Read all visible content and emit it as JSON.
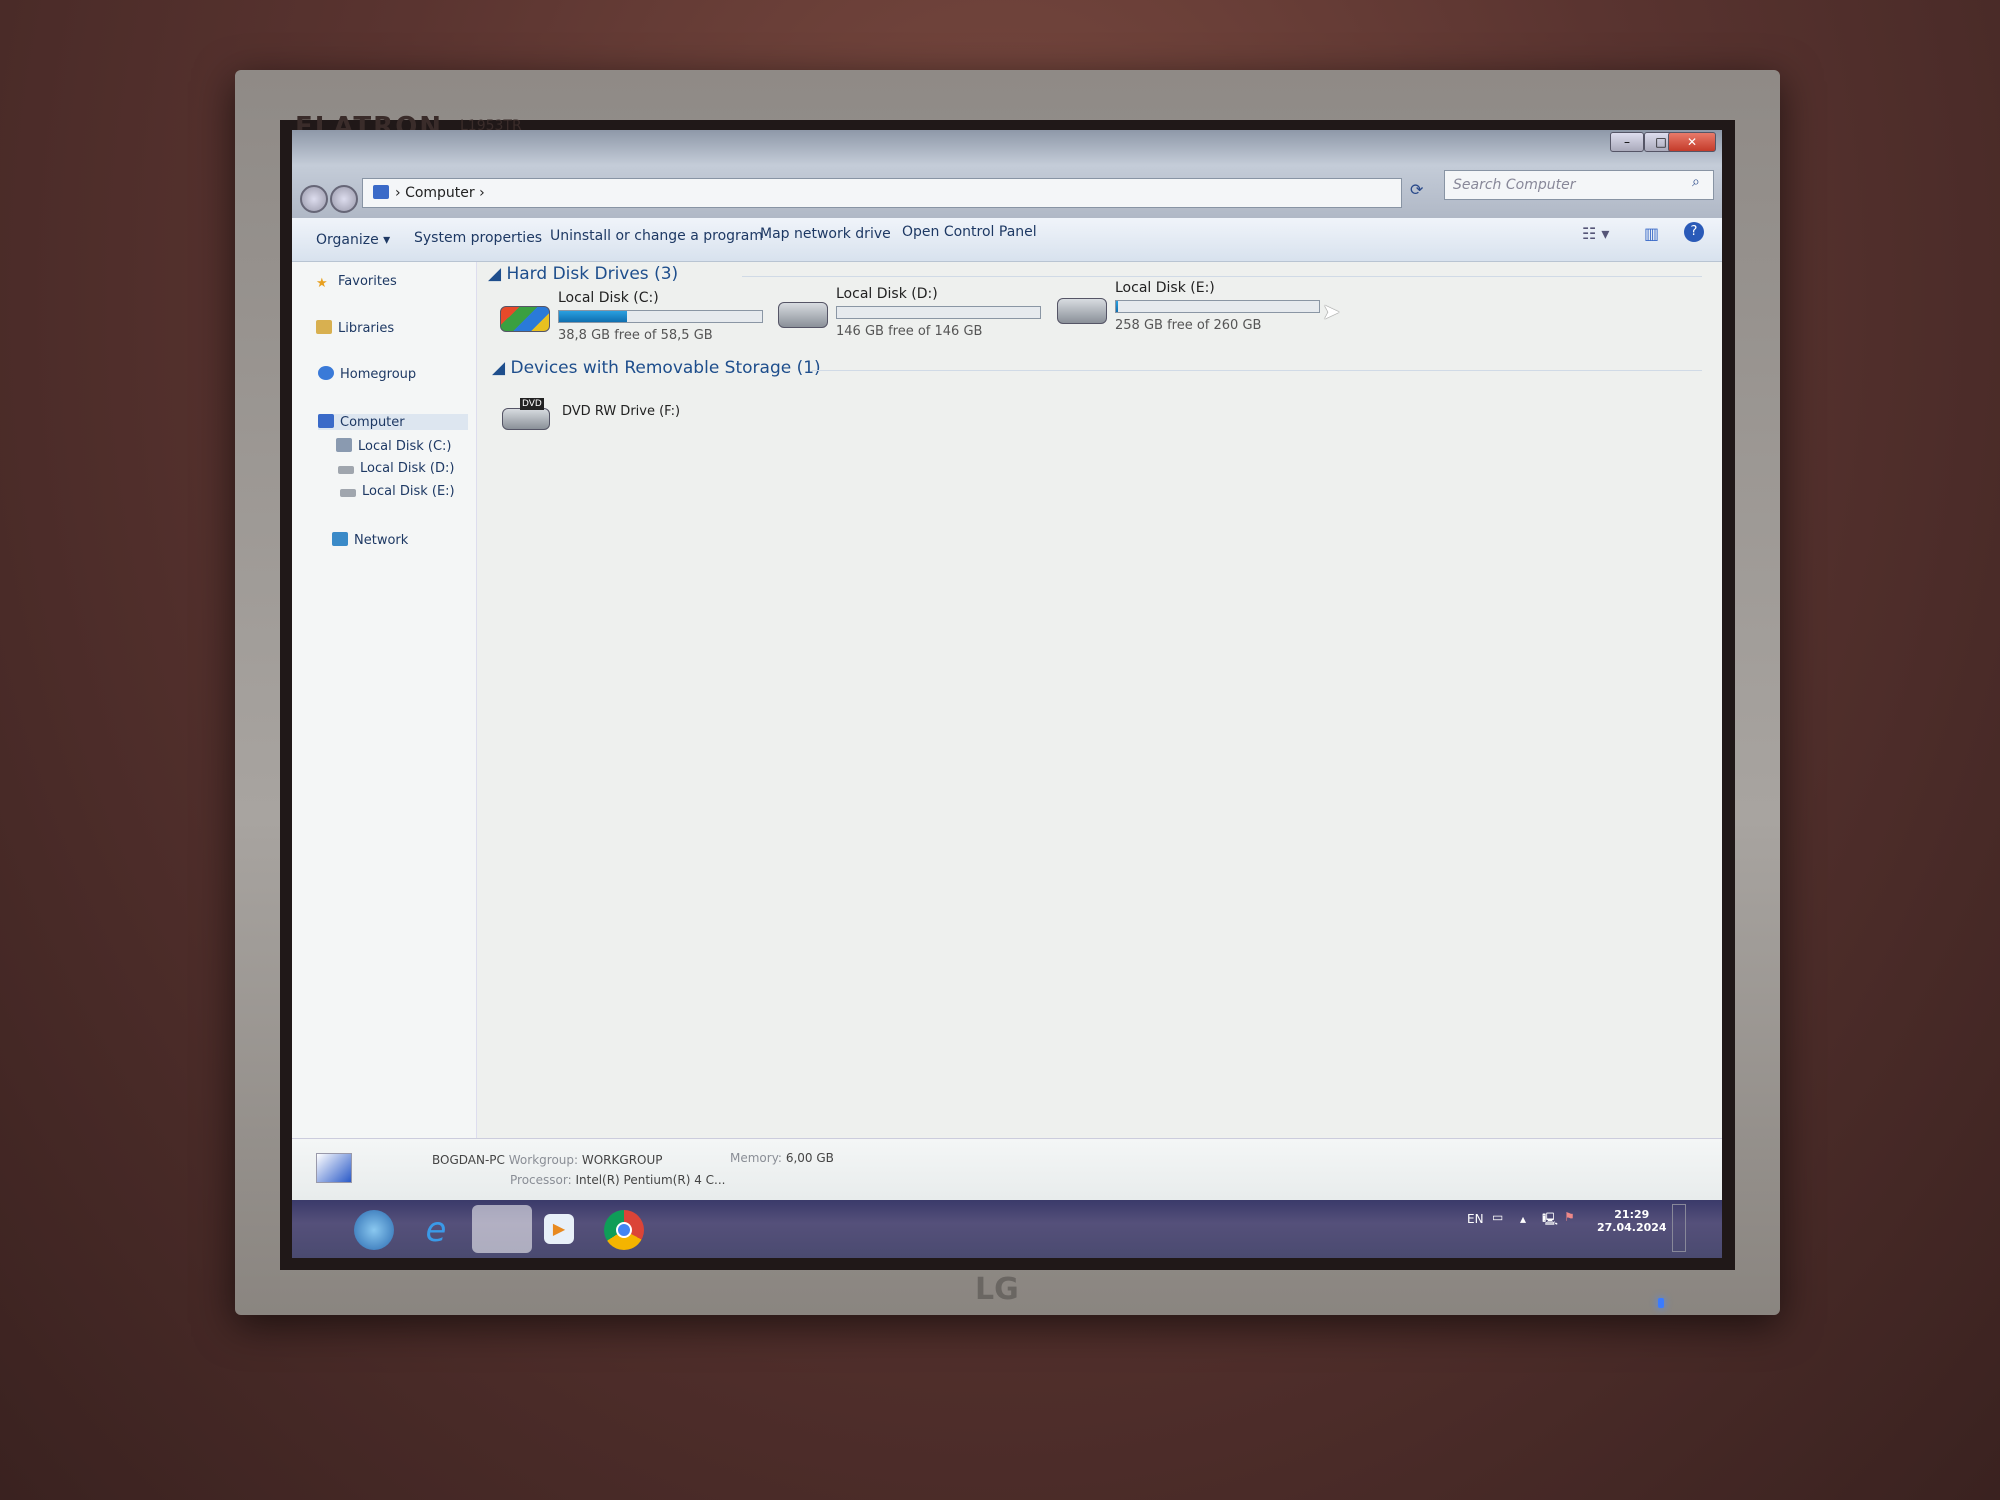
{
  "monitor": {
    "brand": "FLATRON",
    "model": "L1953TR",
    "maker": "LG"
  },
  "window": {
    "address": {
      "crumbs": [
        "Computer"
      ]
    },
    "search_placeholder": "Search Computer",
    "controls": {
      "minimize": "–",
      "maximize": "□",
      "close": "✕"
    }
  },
  "toolbar": {
    "items": [
      "Organize ▾",
      "System properties",
      "Uninstall or change a program",
      "Map network drive",
      "Open Control Panel"
    ]
  },
  "nav": {
    "favorites": "Favorites",
    "libraries": "Libraries",
    "homegroup": "Homegroup",
    "computer": "Computer",
    "drives": [
      "Local Disk (C:)",
      "Local Disk (D:)",
      "Local Disk (E:)"
    ],
    "network": "Network"
  },
  "content": {
    "hdd_header": "Hard Disk Drives (3)",
    "drives": [
      {
        "name": "Local Disk (C:)",
        "info": "38,8 GB free of 58,5 GB",
        "used_percent": 33.7
      },
      {
        "name": "Local Disk (D:)",
        "info": "146 GB free of 146 GB",
        "used_percent": 0
      },
      {
        "name": "Local Disk (E:)",
        "info": "258 GB free of 260 GB",
        "used_percent": 0.8
      }
    ],
    "removable_header": "Devices with Removable Storage (1)",
    "dvd": {
      "name": "DVD RW Drive (F:)",
      "badge": "DVD"
    }
  },
  "details": {
    "pc_name": "BOGDAN-PC",
    "workgroup_label": "Workgroup:",
    "workgroup": "WORKGROUP",
    "memory_label": "Memory:",
    "memory": "6,00 GB",
    "processor_label": "Processor:",
    "processor": "Intel(R) Pentium(R) 4 C..."
  },
  "tray": {
    "lang": "EN",
    "time": "21:29",
    "date": "27.04.2024"
  },
  "colors": {
    "accent": "#1e4e8c",
    "bar_fill": "#1a88c8"
  }
}
